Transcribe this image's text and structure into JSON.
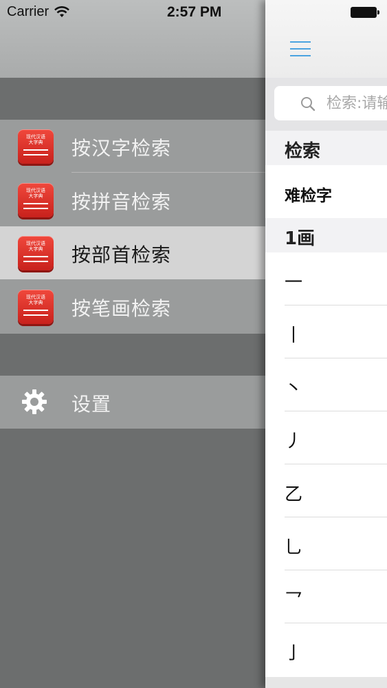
{
  "status_bar": {
    "carrier": "Carrier",
    "time": "2:57 PM"
  },
  "menu": {
    "items": [
      {
        "label": "按汉字检索",
        "icon": "dictionary-book-icon",
        "selected": false
      },
      {
        "label": "按拼音检索",
        "icon": "dictionary-book-icon",
        "selected": false
      },
      {
        "label": "按部首检索",
        "icon": "dictionary-book-icon",
        "selected": true
      },
      {
        "label": "按笔画检索",
        "icon": "dictionary-book-icon",
        "selected": false
      }
    ],
    "book_icon_text": {
      "line1": "现代汉语",
      "line2": "大字典"
    },
    "settings": {
      "label": "设置",
      "icon": "gear-icon"
    }
  },
  "content": {
    "search_placeholder": "检索:请输入",
    "section_search": "检索",
    "rare_char": "难检字",
    "section_1stroke": "1画",
    "radicals": [
      "一",
      "丨",
      "丶",
      "丿",
      "乙",
      "乚",
      "乛",
      "亅"
    ]
  },
  "colors": {
    "accent": "#4aa3e0",
    "icon_red": "#e23a2f",
    "menu_bg": "#6c6e6e"
  }
}
